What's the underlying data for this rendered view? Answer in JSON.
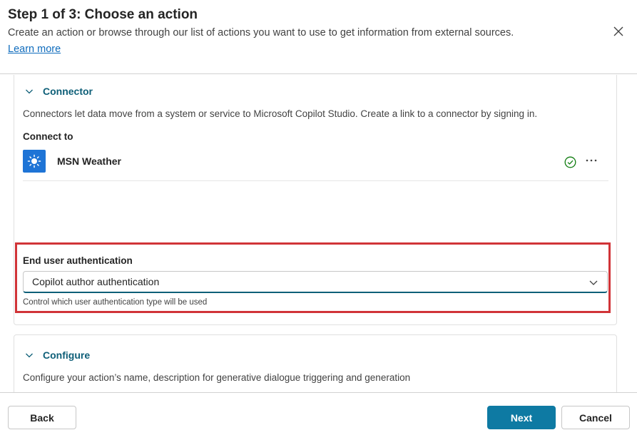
{
  "header": {
    "title": "Step 1 of 3: Choose an action",
    "subtitle": "Create an action or browse through our list of actions you want to use to get information from external sources.",
    "learn_more": "Learn more"
  },
  "connector_section": {
    "title": "Connector",
    "description": "Connectors let data move from a system or service to Microsoft Copilot Studio. Create a link to a connector by signing in.",
    "connect_to_label": "Connect to",
    "connection": {
      "name": "MSN Weather",
      "icon": "sun-icon",
      "status_icon": "check-circle-icon",
      "status_color": "#107c10"
    }
  },
  "auth": {
    "label": "End user authentication",
    "selected_value": "Copilot author authentication",
    "hint": "Control which user authentication type will be used"
  },
  "configure_section": {
    "title": "Configure",
    "description": "Configure your action’s name, description for generative dialogue triggering and generation"
  },
  "footer": {
    "back_label": "Back",
    "next_label": "Next",
    "cancel_label": "Cancel"
  },
  "colors": {
    "accent": "#0e7aa3",
    "section_title": "#0e5f78",
    "highlight": "#d13438",
    "link": "#0f6cbd"
  }
}
